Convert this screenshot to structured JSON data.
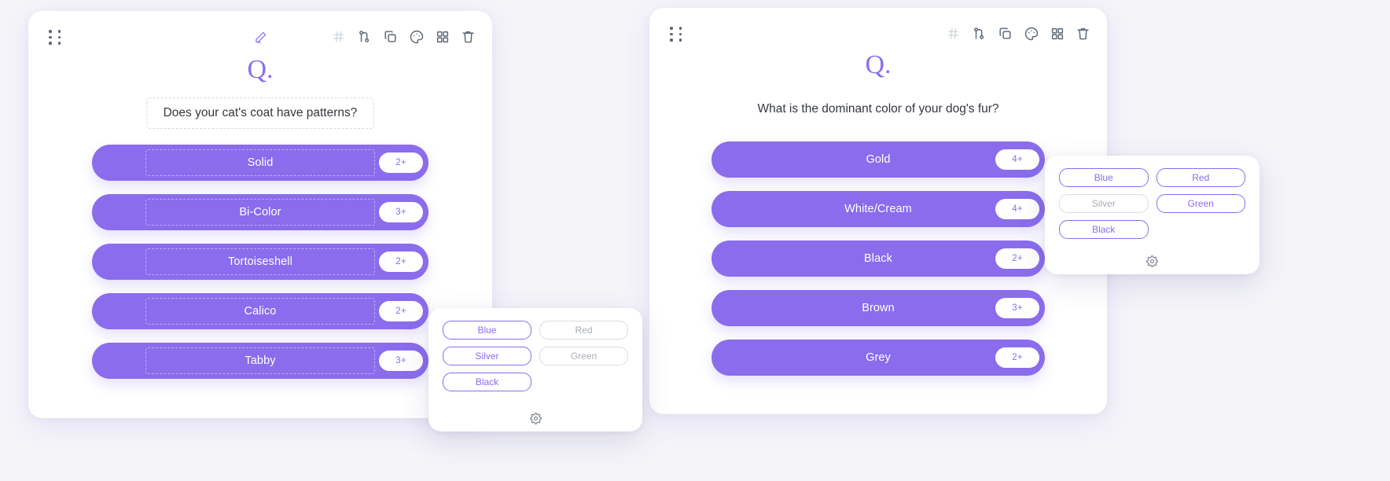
{
  "app": {
    "background_color": "#f4f4f9",
    "accent_color": "#8a6cec",
    "card_color": "#ffffff"
  },
  "cards": [
    {
      "id": "cat-question-card",
      "q_mark": "Q.",
      "question": "Does your cat's coat have patterns?",
      "editable": true,
      "toolbar": {
        "drag_handle": "drag-handle",
        "edit_label": "pencil-icon",
        "tools": [
          {
            "name": "hash-icon",
            "label": "#",
            "muted": true
          },
          {
            "name": "branch-icon",
            "label": "Logic",
            "muted": false
          },
          {
            "name": "copy-icon",
            "label": "Duplicate",
            "muted": false
          },
          {
            "name": "palette-icon",
            "label": "Color",
            "muted": false
          },
          {
            "name": "grid-icon",
            "label": "Layout",
            "muted": false
          },
          {
            "name": "trash-icon",
            "label": "Delete",
            "muted": false
          }
        ]
      },
      "answers": [
        {
          "label": "Solid",
          "badge": "2+"
        },
        {
          "label": "Bi-Color",
          "badge": "3+"
        },
        {
          "label": "Tortoiseshell",
          "badge": "2+"
        },
        {
          "label": "Calico",
          "badge": "2+"
        },
        {
          "label": "Tabby",
          "badge": "3+"
        }
      ]
    },
    {
      "id": "dog-question-card",
      "q_mark": "Q.",
      "question": "What is the dominant color of your dog's fur?",
      "editable": false,
      "toolbar": {
        "drag_handle": "drag-handle",
        "edit_label": "pencil-icon",
        "tools": [
          {
            "name": "hash-icon",
            "label": "#",
            "muted": true
          },
          {
            "name": "branch-icon",
            "label": "Logic",
            "muted": false
          },
          {
            "name": "copy-icon",
            "label": "Duplicate",
            "muted": false
          },
          {
            "name": "palette-icon",
            "label": "Color",
            "muted": false
          },
          {
            "name": "grid-icon",
            "label": "Layout",
            "muted": false
          },
          {
            "name": "trash-icon",
            "label": "Delete",
            "muted": false
          }
        ]
      },
      "answers": [
        {
          "label": "Gold",
          "badge": "4+"
        },
        {
          "label": "White/Cream",
          "badge": "4+"
        },
        {
          "label": "Black",
          "badge": "2+"
        },
        {
          "label": "Brown",
          "badge": "3+"
        },
        {
          "label": "Grey",
          "badge": "2+"
        }
      ]
    }
  ],
  "popups": [
    {
      "id": "cat-color-popup",
      "swatches": [
        {
          "label": "Blue",
          "selected": true
        },
        {
          "label": "Red",
          "selected": false
        },
        {
          "label": "Silver",
          "selected": true
        },
        {
          "label": "Green",
          "selected": false
        },
        {
          "label": "Black",
          "selected": true
        }
      ],
      "gear": "gear-icon"
    },
    {
      "id": "dog-color-popup",
      "swatches": [
        {
          "label": "Blue",
          "selected": true
        },
        {
          "label": "Red",
          "selected": true
        },
        {
          "label": "Silver",
          "selected": false
        },
        {
          "label": "Green",
          "selected": true
        },
        {
          "label": "Black",
          "selected": true
        }
      ],
      "gear": "gear-icon"
    }
  ]
}
